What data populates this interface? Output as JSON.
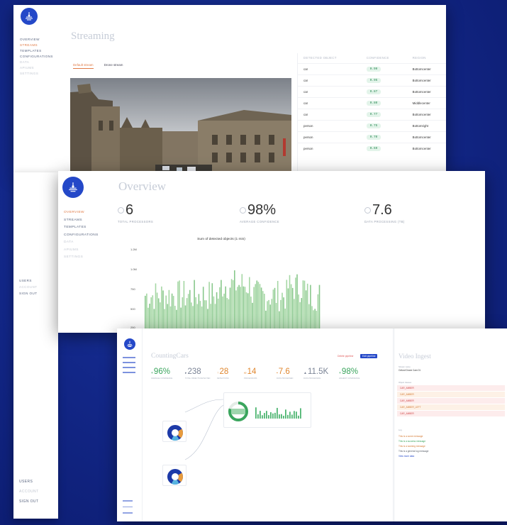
{
  "windows": {
    "streaming": {
      "title": "Streaming",
      "nav": [
        "Overview",
        "Streams",
        "Templates",
        "Configurations",
        "Data",
        "Apiums",
        "Settings"
      ],
      "active_nav": 1,
      "tabs": [
        "Default stream",
        "Drone stream"
      ],
      "detections": {
        "headers": [
          "Detected object",
          "Confidence",
          "Region"
        ],
        "rows": [
          [
            "car",
            "0.99",
            "Bottomcenter"
          ],
          [
            "car",
            "0.95",
            "Bottomcenter"
          ],
          [
            "car",
            "0.87",
            "Bottomcenter"
          ],
          [
            "car",
            "0.80",
            "Middlecenter"
          ],
          [
            "car",
            "0.77",
            "Bottomcenter"
          ],
          [
            "person",
            "0.75",
            "Bottomright"
          ],
          [
            "person",
            "0.70",
            "Bottomcenter"
          ],
          [
            "person",
            "0.69",
            "Bottomcenter"
          ]
        ]
      }
    },
    "overview": {
      "title": "Overview",
      "nav": [
        "Overview",
        "Streams",
        "Templates",
        "Configurations",
        "Data",
        "Apiums",
        "Settings"
      ],
      "active_nav": 0,
      "stats": [
        {
          "value": "6",
          "label": "Total processors",
          "icon": "processor-icon"
        },
        {
          "value": "98%",
          "label": "Average confidence",
          "icon": "confidence-icon"
        },
        {
          "value": "7.6",
          "label": "Data processing (TB)",
          "icon": "database-icon"
        }
      ],
      "chart_title": "Sum of detected objects (1 min)",
      "y_ticks": [
        "1.2M",
        "1.0M",
        "750",
        "500",
        "250"
      ]
    },
    "counting": {
      "title": "CountingCars",
      "kpis": [
        {
          "value": "96%",
          "color": "#3aa55d",
          "label": "Average confidence"
        },
        {
          "value": "238",
          "color": "#7b8496",
          "label": "Total objects detected"
        },
        {
          "value": "28",
          "color": "#e0862e",
          "label": "Detections"
        },
        {
          "value": "14",
          "color": "#e0862e",
          "label": "Processors"
        },
        {
          "value": "7.6",
          "color": "#e0862e",
          "label": "Data processed"
        },
        {
          "value": "11.5K",
          "color": "#7b8496",
          "label": "Data processing"
        },
        {
          "value": "98%",
          "color": "#3aa55d",
          "label": "Highest confidence"
        }
      ],
      "buttons": {
        "outline": "Delete pipeline",
        "filled": "Edit pipeline"
      },
      "panel": {
        "title": "Video Ingest",
        "field_label": "Stream name",
        "field_value": "Oxford Drone Cam 01",
        "tags_label": "Object classes",
        "tags": [
          "CAR_AMBER",
          "CAR_AMBER",
          "CAR_AMBER",
          "CAR_AMBER_LEFT",
          "CAR_AMBER"
        ],
        "log_label": "Log",
        "logs": [
          {
            "text": "This is a some message",
            "color": "#d57a33"
          },
          {
            "text": "This is a success message",
            "color": "#3aa55d"
          },
          {
            "text": "This is a warning message",
            "color": "#d57a33"
          },
          {
            "text": "This is a general log message",
            "color": "#555b66"
          },
          {
            "text": "View more data",
            "color": "#2448c8"
          }
        ]
      }
    },
    "sidebar_bottom": [
      "Users",
      "Account",
      "Sign out"
    ]
  }
}
